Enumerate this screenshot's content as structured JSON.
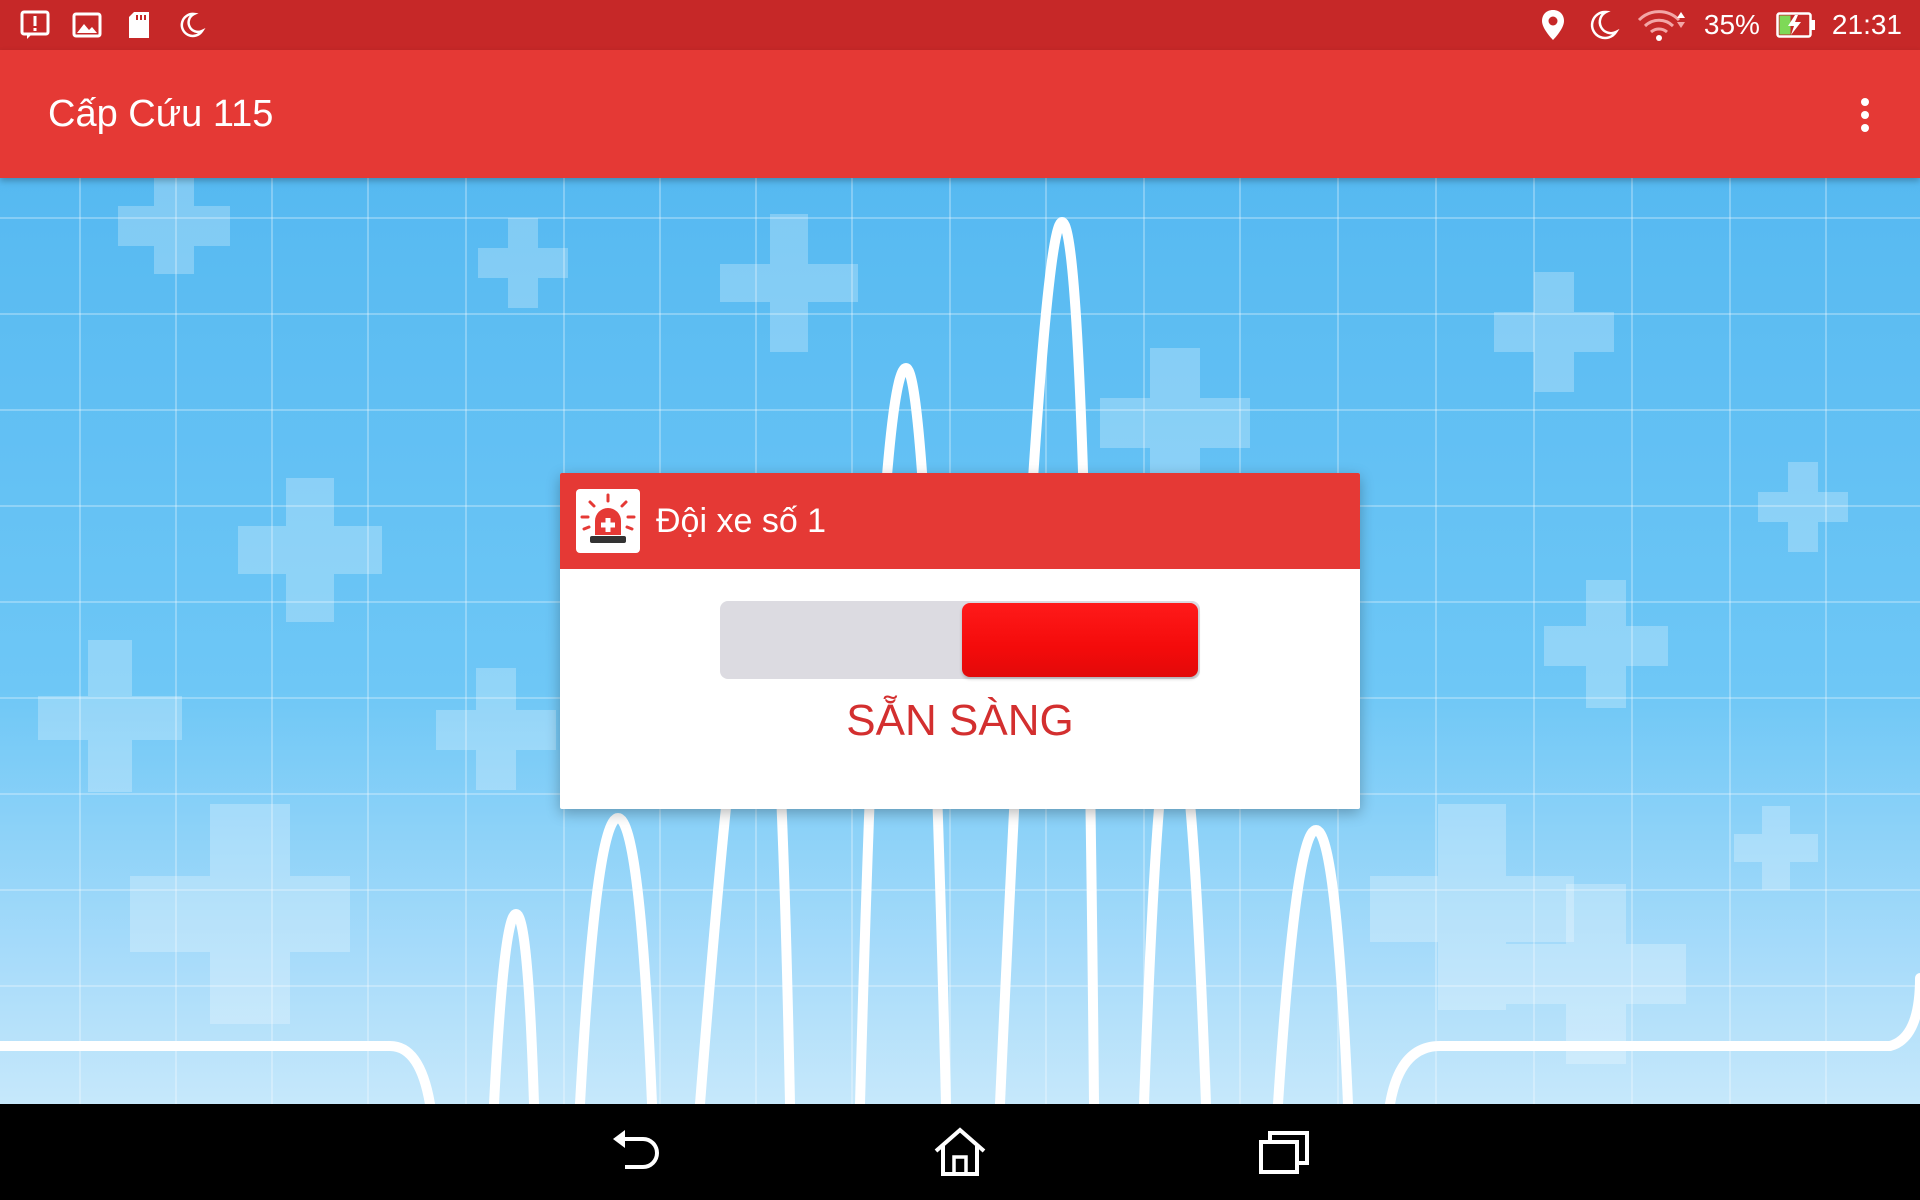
{
  "status_bar": {
    "battery_percent": "35%",
    "time": "21:31",
    "left_icons": [
      "alert-icon",
      "image-icon",
      "sd-card-icon",
      "moon-icon"
    ],
    "right_icons": [
      "location-icon",
      "moon-icon",
      "wifi-icon",
      "battery-charging-icon"
    ]
  },
  "app_bar": {
    "title": "Cấp Cứu 115",
    "menu_icon": "more-vert-icon"
  },
  "dialog": {
    "title": "Đội xe số 1",
    "icon": "ambulance-siren-icon",
    "toggle_state": "on",
    "toggle_position_fraction": 1.0,
    "status_label": "SẴN SÀNG"
  },
  "nav_bar": {
    "buttons": [
      "back-icon",
      "home-icon",
      "recents-icon"
    ]
  },
  "colors": {
    "status_bar": "#c62828",
    "app_bar": "#e53935",
    "accent_red": "#f40b0b",
    "status_text": "#d32f2f",
    "background_blue": "#5bbcf2"
  }
}
